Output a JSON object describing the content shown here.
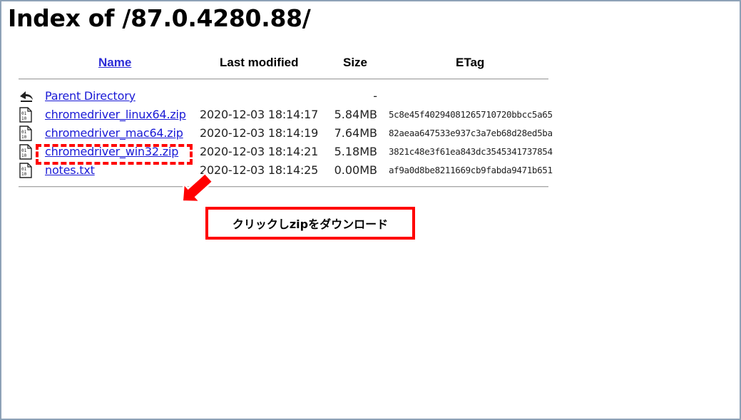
{
  "page": {
    "title": "Index of /87.0.4280.88/"
  },
  "table": {
    "headers": {
      "name": "Name",
      "last_modified": "Last modified",
      "size": "Size",
      "etag": "ETag"
    },
    "rows": [
      {
        "name": "Parent Directory",
        "date": "",
        "size": "-",
        "etag": "",
        "icon": "back-arrow-icon"
      },
      {
        "name": "chromedriver_linux64.zip",
        "date": "2020-12-03 18:14:17",
        "size": "5.84MB",
        "etag": "5c8e45f40294081265710720bbcc5a65",
        "icon": "binary-file-icon"
      },
      {
        "name": "chromedriver_mac64.zip",
        "date": "2020-12-03 18:14:19",
        "size": "7.64MB",
        "etag": "82aeaa647533e937c3a7eb68d28ed5ba",
        "icon": "binary-file-icon"
      },
      {
        "name": "chromedriver_win32.zip",
        "date": "2020-12-03 18:14:21",
        "size": "5.18MB",
        "etag": "3821c48e3f61ea843dc3545341737854",
        "icon": "binary-file-icon"
      },
      {
        "name": "notes.txt",
        "date": "2020-12-03 18:14:25",
        "size": "0.00MB",
        "etag": "af9a0d8be8211669cb9fabda9471b651",
        "icon": "binary-file-icon"
      }
    ]
  },
  "annotation": {
    "callout_text": "クリックしzipをダウンロード",
    "highlight_color": "#ff0000",
    "highlighted_row": "chromedriver_win32.zip"
  }
}
